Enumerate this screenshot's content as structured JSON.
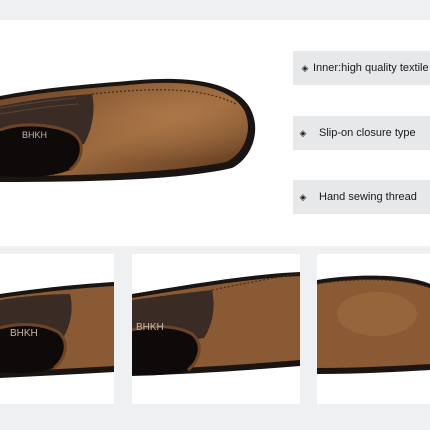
{
  "features": [
    {
      "icon": "diamond-bullet-icon",
      "text": "Inner:high quality textile"
    },
    {
      "icon": "diamond-bullet-icon",
      "text": "Slip-on closure type"
    },
    {
      "icon": "diamond-bullet-icon",
      "text": "Hand sewing thread"
    }
  ],
  "brand_mark": "BHKH",
  "colors": {
    "leather": "#8a5a34",
    "leather_dark": "#4a2a14",
    "elastic": "#3a2c24",
    "sole": "#1a1512",
    "feature_bg": "#e6e8ea",
    "page_bg": "#eef0f2"
  }
}
